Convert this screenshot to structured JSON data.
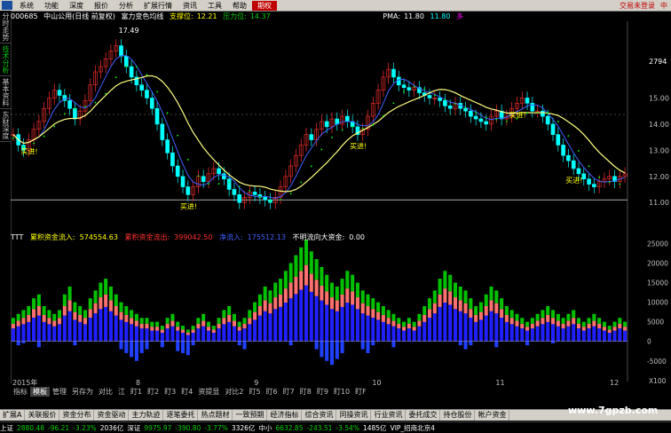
{
  "menu": {
    "items": [
      "系统",
      "功能",
      "深度",
      "报价",
      "分析",
      "扩展行情",
      "资讯",
      "工具",
      "帮助",
      "期权"
    ],
    "active_index": 9,
    "right_items": [
      "交易未登录",
      "中"
    ]
  },
  "side_tabs": [
    {
      "label": "分时走势",
      "green": false
    },
    {
      "label": "技术分析",
      "green": true
    },
    {
      "label": "基本资料",
      "green": false
    },
    {
      "label": "东财深度",
      "green": false
    }
  ],
  "header": {
    "code": "000685",
    "name": "中山公用(日线 前复权)",
    "indicator_name": "富力变色均线",
    "support_label": "支撑位:",
    "support_value": "12.21",
    "resistance_label": "压力位:",
    "resistance_value": "14.37",
    "pma_label": "PMA:",
    "pma_value": "11.80",
    "pma_value2": "11.80",
    "extra_mark": "多"
  },
  "price_axis": {
    "top_label": "2794",
    "ticks": [
      "15.00",
      "14.00",
      "13.00",
      "12.00",
      "11.00"
    ]
  },
  "annotations": {
    "peak_label": "17.49",
    "buy_labels": [
      "买进!",
      "买进!",
      "买进!",
      "买进!",
      "买进!"
    ]
  },
  "fund_flow": {
    "ttt_label": "TTT",
    "inflow_label": "累积资金流入:",
    "inflow_value": "574554.63",
    "outflow_label": "累积资金流出:",
    "outflow_value": "399042.50",
    "net_label": "净流入:",
    "net_value": "175512.13",
    "unknown_label": "不明流向大资金:",
    "unknown_value": "0.00"
  },
  "volume_axis": {
    "ticks": [
      "25000",
      "20000",
      "15000",
      "10000",
      "5000",
      "0",
      "-5000"
    ],
    "bottom_label": "X100"
  },
  "time_axis": {
    "labels": [
      "2015年",
      "8",
      "9",
      "10",
      "11",
      "12"
    ]
  },
  "indicator_tabs": [
    "指标",
    "模板",
    "管理",
    "另存为",
    "对比",
    "江",
    "盯1",
    "盯2",
    "盯3",
    "盯4",
    "资提显",
    "对比2",
    "盯5",
    "盯6",
    "盯7",
    "盯8",
    "盯9",
    "盯10",
    "盯F"
  ],
  "bottom_tabs_1": [
    "扩展A",
    "关联报价",
    "资金分布",
    "资金驱动",
    "主力轨迹",
    "逐笔委托",
    "热点题材",
    "一致预期",
    "经济指标",
    "综合资讯",
    "同操资讯",
    "行业资讯",
    "委托成交",
    "持仓股份",
    "帐户资金"
  ],
  "status_bar": [
    {
      "text": "上证",
      "color": "white"
    },
    {
      "text": "2880.48",
      "color": "green"
    },
    {
      "text": "-96.21",
      "color": "green"
    },
    {
      "text": "-3.23%",
      "color": "green"
    },
    {
      "text": "2036亿",
      "color": "white"
    },
    {
      "text": "深证",
      "color": "white"
    },
    {
      "text": "9975.97",
      "color": "green"
    },
    {
      "text": "-390.80",
      "color": "green"
    },
    {
      "text": "-3.77%",
      "color": "green"
    },
    {
      "text": "3326亿",
      "color": "white"
    },
    {
      "text": "中小",
      "color": "white"
    },
    {
      "text": "6632.85",
      "color": "green"
    },
    {
      "text": "-243.51",
      "color": "green"
    },
    {
      "text": "-3.54%",
      "color": "green"
    },
    {
      "text": "1485亿",
      "color": "white"
    },
    {
      "text": "VIP_招商北京4",
      "color": "white"
    }
  ],
  "watermark": "www.7gpzb.com",
  "chart_data": {
    "type": "candlestick",
    "ylim": [
      10.6,
      17.8
    ],
    "closes": [
      13.6,
      13.2,
      13.0,
      13.4,
      13.8,
      14.1,
      14.6,
      15.0,
      15.3,
      15.1,
      14.9,
      14.6,
      14.2,
      14.5,
      14.9,
      15.5,
      16.0,
      16.2,
      16.5,
      16.8,
      17.0,
      16.6,
      16.2,
      15.8,
      15.5,
      15.3,
      15.0,
      14.6,
      14.0,
      13.4,
      12.9,
      12.4,
      12.0,
      11.6,
      11.3,
      11.6,
      12.0,
      11.8,
      12.1,
      12.3,
      12.1,
      11.9,
      11.5,
      11.3,
      11.0,
      11.2,
      11.4,
      11.3,
      11.2,
      11.1,
      11.0,
      11.2,
      11.6,
      12.0,
      12.4,
      12.8,
      13.2,
      13.6,
      13.4,
      13.8,
      14.1,
      13.9,
      14.2,
      14.0,
      14.3,
      14.1,
      13.9,
      13.6,
      13.8,
      14.3,
      14.8,
      15.3,
      15.8,
      16.1,
      15.8,
      15.5,
      15.4,
      15.3,
      15.4,
      15.2,
      15.1,
      15.0,
      15.0,
      14.9,
      14.7,
      14.6,
      14.8,
      14.6,
      14.5,
      14.3,
      14.2,
      14.1,
      14.0,
      14.3,
      14.5,
      14.2,
      14.3,
      14.6,
      14.8,
      15.0,
      14.8,
      14.5,
      14.5,
      14.3,
      14.0,
      13.6,
      13.2,
      12.8,
      12.6,
      12.3,
      12.1,
      11.9,
      11.7,
      11.6,
      11.8,
      11.9,
      12.0,
      11.8,
      12.0,
      12.1
    ]
  },
  "volume_data": {
    "pos": [
      6000,
      7000,
      8000,
      9000,
      11000,
      12000,
      9000,
      8000,
      7000,
      8000,
      12000,
      14000,
      10000,
      9000,
      8000,
      11000,
      13000,
      15000,
      16000,
      14000,
      12000,
      10000,
      9000,
      8000,
      7000,
      6000,
      6000,
      5000,
      5000,
      4000,
      6000,
      7000,
      5000,
      4000,
      3000,
      4000,
      6000,
      7000,
      5000,
      4000,
      6000,
      8000,
      9000,
      7000,
      5000,
      6000,
      8000,
      10000,
      12000,
      14000,
      13000,
      15000,
      16000,
      18000,
      20000,
      22000,
      24000,
      26000,
      23000,
      21000,
      19000,
      17000,
      15000,
      14000,
      16000,
      18000,
      17000,
      15000,
      13000,
      12000,
      11000,
      10000,
      9000,
      8000,
      7000,
      6000,
      5000,
      6000,
      5000,
      7000,
      9000,
      11000,
      13000,
      16000,
      18000,
      17000,
      15000,
      14000,
      13000,
      11000,
      9000,
      10000,
      12000,
      14000,
      13000,
      11000,
      9000,
      8000,
      7000,
      6000,
      5000,
      6000,
      7000,
      8000,
      9000,
      8000,
      7000,
      6000,
      7000,
      8000,
      6000,
      5000,
      6000,
      7000,
      6000,
      5000,
      4000,
      5000,
      6000,
      5000
    ],
    "neg": [
      0,
      -1000,
      -500,
      0,
      0,
      -1500,
      0,
      0,
      0,
      0,
      0,
      0,
      -1000,
      0,
      0,
      0,
      0,
      0,
      0,
      0,
      0,
      -2000,
      -3000,
      -4000,
      -5000,
      -3000,
      -2000,
      0,
      0,
      -1500,
      0,
      0,
      -2500,
      -3000,
      -3500,
      -1000,
      0,
      0,
      0,
      0,
      0,
      0,
      0,
      0,
      -1000,
      -2000,
      0,
      0,
      0,
      0,
      0,
      0,
      0,
      0,
      -1000,
      0,
      0,
      0,
      0,
      -2000,
      -4000,
      -5000,
      -6000,
      -4500,
      -3000,
      0,
      0,
      0,
      -2000,
      -3000,
      -1000,
      0,
      0,
      0,
      -1500,
      0,
      0,
      0,
      0,
      0,
      0,
      0,
      0,
      0,
      0,
      0,
      0,
      -1000,
      -2000,
      -1000,
      0,
      0,
      0,
      0,
      -1500,
      0,
      0,
      0,
      0,
      0,
      -1000,
      0,
      0,
      0,
      0,
      -500,
      0,
      0,
      0,
      0,
      0,
      0,
      0,
      0,
      0,
      0,
      0,
      0,
      0,
      0
    ]
  }
}
